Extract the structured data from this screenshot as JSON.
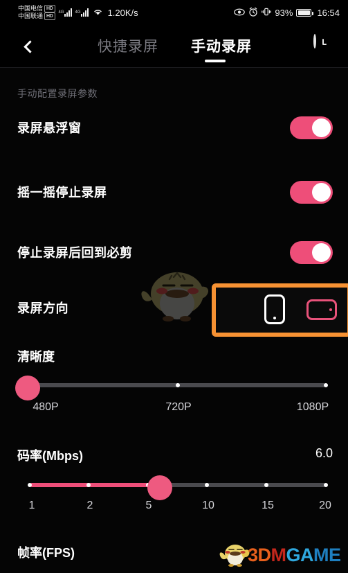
{
  "statusbar": {
    "carrier_primary": "中国电信",
    "carrier_secondary": "中国联通",
    "hd_badge": "HD",
    "network_gen_1": "4G",
    "network_gen_2": "4G",
    "wifi_icon": "wifi-icon",
    "net_speed": "1.20K/s",
    "eye_icon": "eye-icon",
    "alarm_icon": "alarm-clock-icon",
    "vibrate_icon": "vibrate-icon",
    "battery_percent": "93%",
    "battery_icon": "battery-icon",
    "time": "16:54"
  },
  "navbar": {
    "back_icon": "back-chevron-icon",
    "history_icon": "history-clock-icon",
    "tabs": [
      {
        "label": "快捷录屏",
        "active": false
      },
      {
        "label": "手动录屏",
        "active": true
      }
    ]
  },
  "content": {
    "section_caption": "手动配置录屏参数",
    "options": [
      {
        "label": "录屏悬浮窗",
        "toggle": "on"
      },
      {
        "label": "摇一摇停止录屏",
        "toggle": "on"
      },
      {
        "label": "停止录屏后回到必剪",
        "toggle": "on"
      }
    ],
    "orientation": {
      "label": "录屏方向",
      "highlight_color": "#F79233",
      "choices": [
        {
          "name": "portrait",
          "icon": "phone-portrait-icon",
          "selected": false
        },
        {
          "name": "landscape",
          "icon": "phone-landscape-icon",
          "selected": true
        }
      ]
    },
    "clarity": {
      "title": "清晰度",
      "scale": [
        "480P",
        "720P",
        "1080P"
      ],
      "selected": "480P"
    },
    "bitrate": {
      "title": "码率(Mbps)",
      "value": "6.0",
      "scale": [
        "1",
        "2",
        "5",
        "10",
        "15",
        "20"
      ]
    },
    "fps": {
      "title": "帧率(FPS)"
    }
  },
  "watermark": {
    "text_1": "3D",
    "text_2": "M",
    "text_3": "GA",
    "text_4": "ME",
    "bird_icon": "chick-mascot-icon"
  },
  "colors": {
    "accent_pink": "#EE4E79",
    "highlight_orange": "#F79233",
    "background": "#050505"
  }
}
